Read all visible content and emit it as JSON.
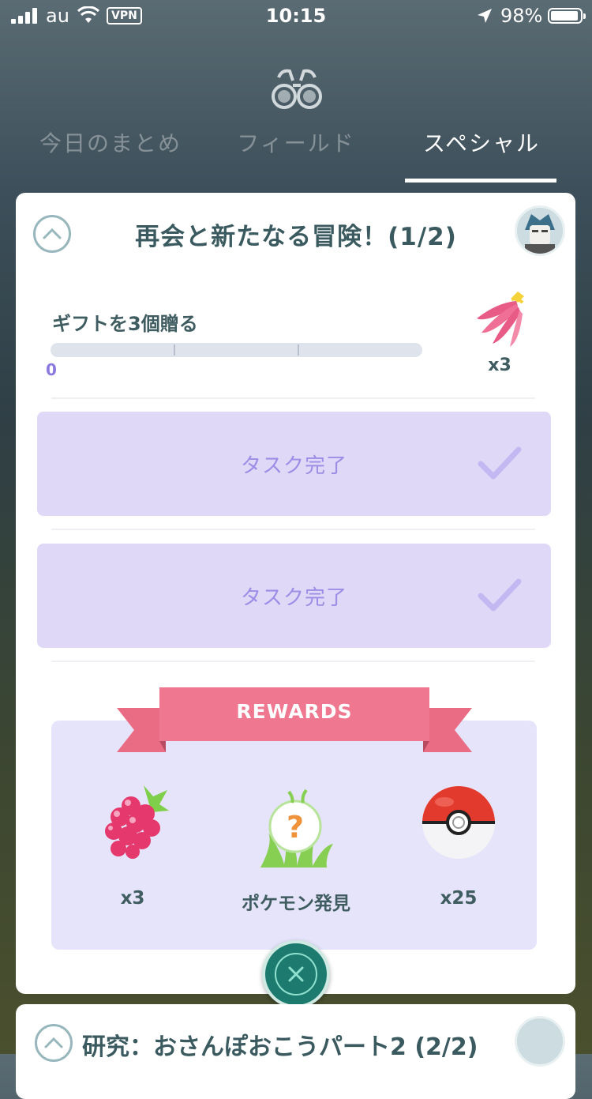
{
  "status_bar": {
    "carrier": "au",
    "vpn": "VPN",
    "time": "10:15",
    "battery": "98%"
  },
  "tabs": [
    {
      "label": "今日のまとめ",
      "active": false
    },
    {
      "label": "フィールド",
      "active": false
    },
    {
      "label": "スペシャル",
      "active": true
    }
  ],
  "research": {
    "title": "再会と新たなる冒険！(1/2)",
    "task": {
      "text": "ギフトを3個贈る",
      "progress_current": "0",
      "progress_total": 3,
      "reward_count": "x3",
      "reward_icon": "banana-berry-icon"
    },
    "completed_tasks": [
      {
        "label": "タスク完了"
      },
      {
        "label": "タスク完了"
      }
    ],
    "rewards_title": "REWARDS",
    "rewards": [
      {
        "icon": "razz-berry-icon",
        "label": "x3"
      },
      {
        "icon": "pokemon-encounter-icon",
        "label": "ポケモン発見"
      },
      {
        "icon": "pokeball-icon",
        "label": "x25"
      }
    ]
  },
  "next_research": {
    "title": "研究：おさんぽおこうパート2 (2/2)"
  },
  "colors": {
    "accent_purple": "#9d8de6",
    "task_done_bg": "#e0d8f7",
    "ribbon": "#ea6b84",
    "close_button": "#1d7a6f"
  }
}
